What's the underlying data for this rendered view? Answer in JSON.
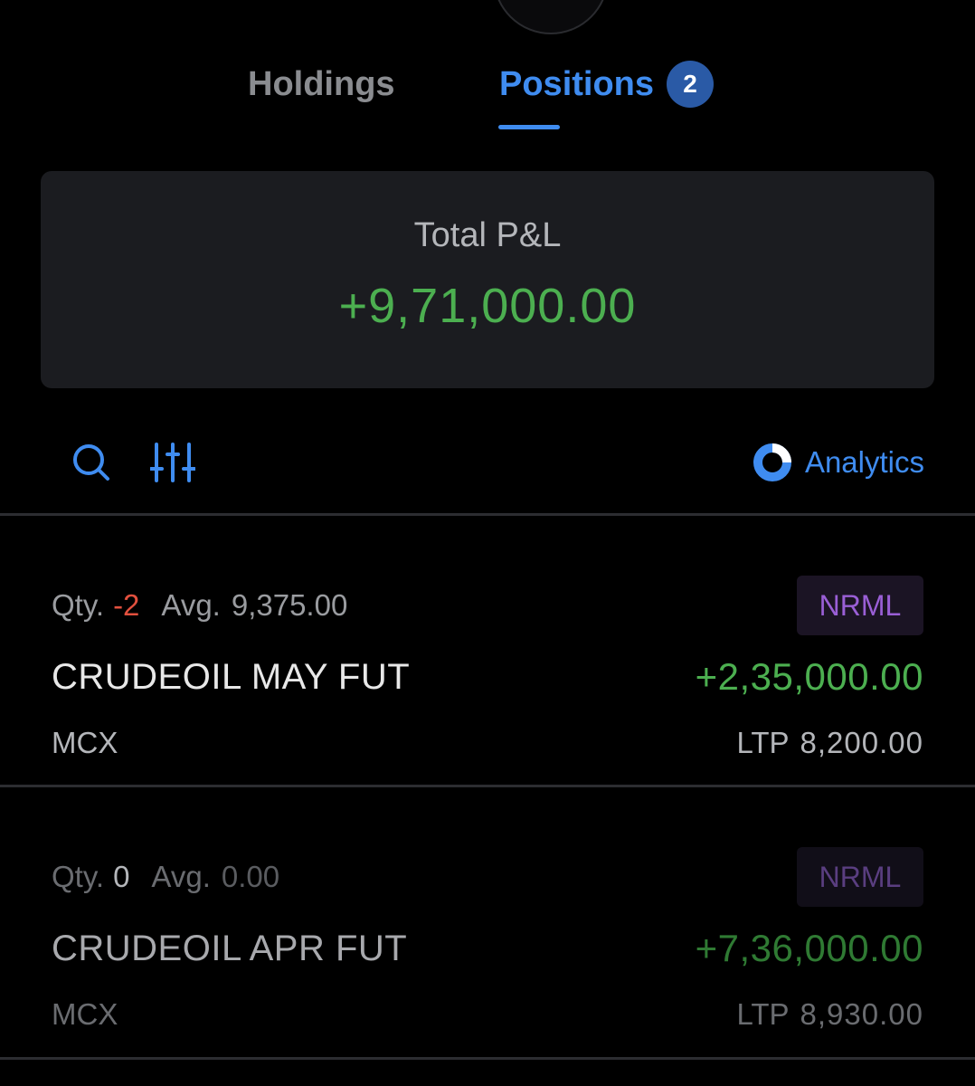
{
  "tabs": {
    "holdings_label": "Holdings",
    "positions_label": "Positions",
    "positions_count": "2",
    "active": "Positions"
  },
  "summary": {
    "label": "Total P&L",
    "value": "+9,71,000.00"
  },
  "toolbar": {
    "search_icon": "search-icon",
    "filter_icon": "sliders-icon",
    "analytics_icon": "analytics-donut-icon",
    "analytics_label": "Analytics"
  },
  "positions": [
    {
      "qty_label": "Qty.",
      "qty": "-2",
      "avg_label": "Avg.",
      "avg": "9,375.00",
      "product": "NRML",
      "symbol": "CRUDEOIL MAY FUT",
      "pnl": "+2,35,000.00",
      "exchange": "MCX",
      "ltp_label": "LTP",
      "ltp": "8,200.00"
    },
    {
      "qty_label": "Qty.",
      "qty": "0",
      "avg_label": "Avg.",
      "avg": "0.00",
      "product": "NRML",
      "symbol": "CRUDEOIL APR FUT",
      "pnl": "+7,36,000.00",
      "exchange": "MCX",
      "ltp_label": "LTP",
      "ltp": "8,930.00"
    }
  ],
  "colors": {
    "background": "#000000",
    "accent": "#3f8cf0",
    "profit": "#4caf50",
    "loss": "#e2503e",
    "product_tag": "#9a5fd6",
    "card": "#1b1c20"
  }
}
